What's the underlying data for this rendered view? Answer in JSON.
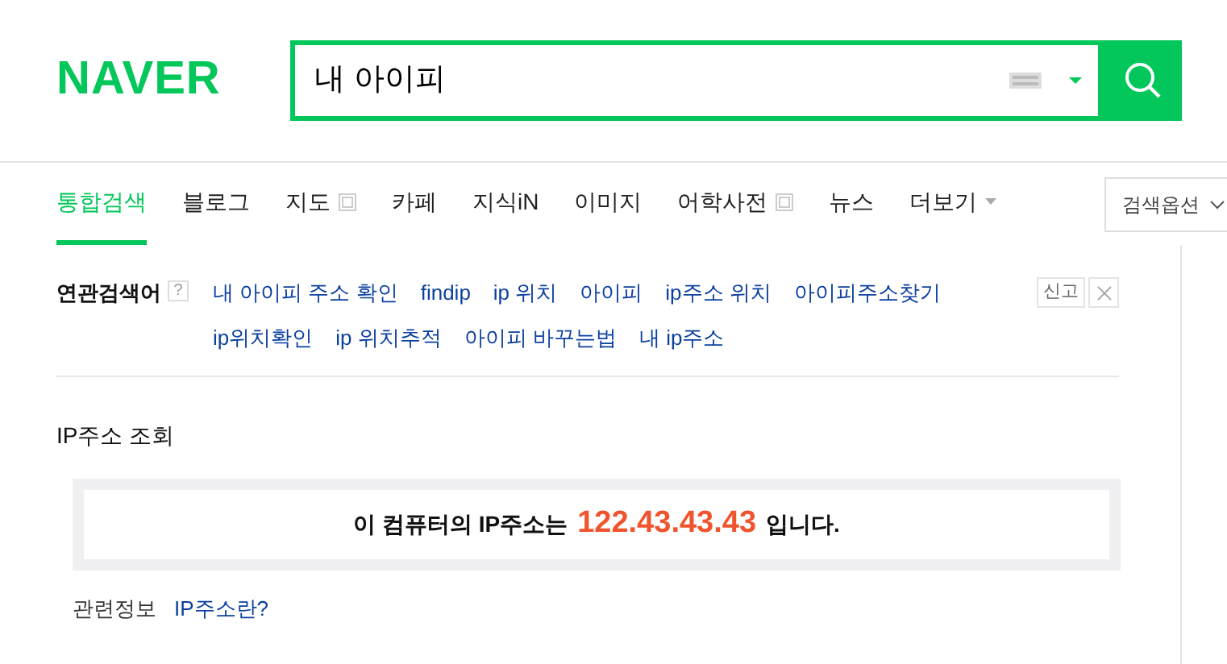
{
  "logo": "NAVER",
  "search": {
    "value": "내 아이피"
  },
  "tabs": [
    {
      "label": "통합검색",
      "selected": true,
      "kind": "plain"
    },
    {
      "label": "블로그",
      "selected": false,
      "kind": "plain"
    },
    {
      "label": "지도",
      "selected": false,
      "kind": "popup"
    },
    {
      "label": "카페",
      "selected": false,
      "kind": "plain"
    },
    {
      "label": "지식iN",
      "selected": false,
      "kind": "plain"
    },
    {
      "label": "이미지",
      "selected": false,
      "kind": "plain"
    },
    {
      "label": "어학사전",
      "selected": false,
      "kind": "popup"
    },
    {
      "label": "뉴스",
      "selected": false,
      "kind": "plain"
    },
    {
      "label": "더보기",
      "selected": false,
      "kind": "more"
    }
  ],
  "search_options": "검색옵션",
  "related": {
    "title": "연관검색어",
    "help": "?",
    "report": "신고",
    "keywords": [
      "내 아이피 주소 확인",
      "findip",
      "ip 위치",
      "아이피",
      "ip주소 위치",
      "아이피주소찾기",
      "ip위치확인",
      "ip 위치추적",
      "아이피 바꾸는법",
      "내 ip주소"
    ]
  },
  "ip_lookup": {
    "title": "IP주소 조회",
    "prefix": "이 컴퓨터의 IP주소는",
    "ip": "122.43.43.43",
    "suffix": "입니다.",
    "info_label": "관련정보",
    "info_link": "IP주소란?"
  }
}
